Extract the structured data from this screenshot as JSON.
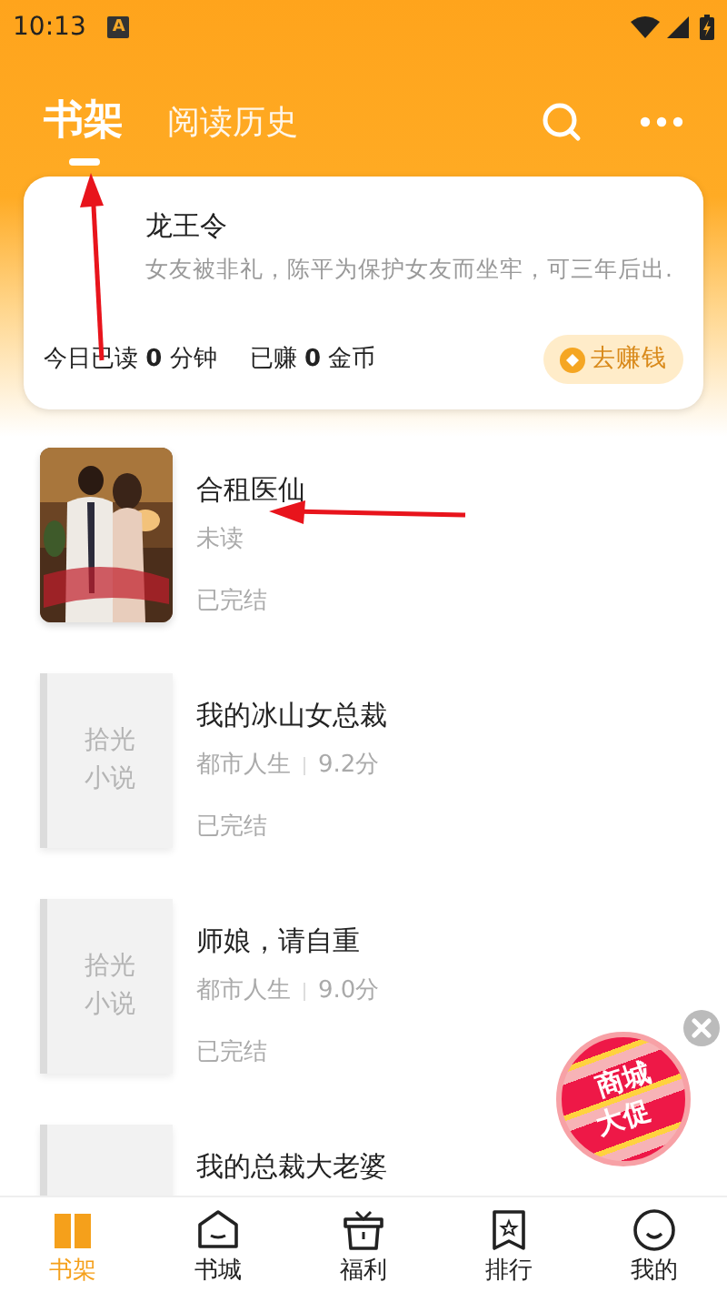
{
  "status_bar": {
    "time": "10:13",
    "badge": "A"
  },
  "tabs": [
    {
      "label": "书架",
      "selected": true
    },
    {
      "label": "阅读历史",
      "selected": false
    }
  ],
  "recent_card": {
    "title": "龙王令",
    "description": "女友被非礼，陈平为保护女友而坐牢，可三年后出.",
    "stats": [
      "今日已读 **0** 分钟",
      "已赚 **0** 金币"
    ],
    "button": "去赚钱"
  },
  "books": [
    {
      "cover": {
        "kind": "picture"
      },
      "title": "合租医仙",
      "meta": [
        "未读"
      ],
      "status": "已完结"
    },
    {
      "cover": {
        "kind": "placeholder",
        "text": [
          "拾光",
          "小说"
        ]
      },
      "title": "我的冰山女总裁",
      "meta": [
        "都市人生",
        "9.2分"
      ],
      "status": "已完结"
    },
    {
      "cover": {
        "kind": "placeholder",
        "text": [
          "拾光",
          "小说"
        ]
      },
      "title": "师娘，请自重",
      "meta": [
        "都市人生",
        "9.0分"
      ],
      "status": "已完结"
    },
    {
      "cover": {
        "kind": "placeholder"
      },
      "title": "我的总裁大老婆"
    }
  ],
  "promo_badge": {
    "lines": [
      "商城",
      "大促"
    ]
  },
  "nav": [
    {
      "label": "书架",
      "selected": true
    },
    {
      "label": "书城",
      "selected": false
    },
    {
      "label": "福利",
      "selected": false
    },
    {
      "label": "排行",
      "selected": false
    },
    {
      "label": "我的",
      "selected": false
    }
  ]
}
